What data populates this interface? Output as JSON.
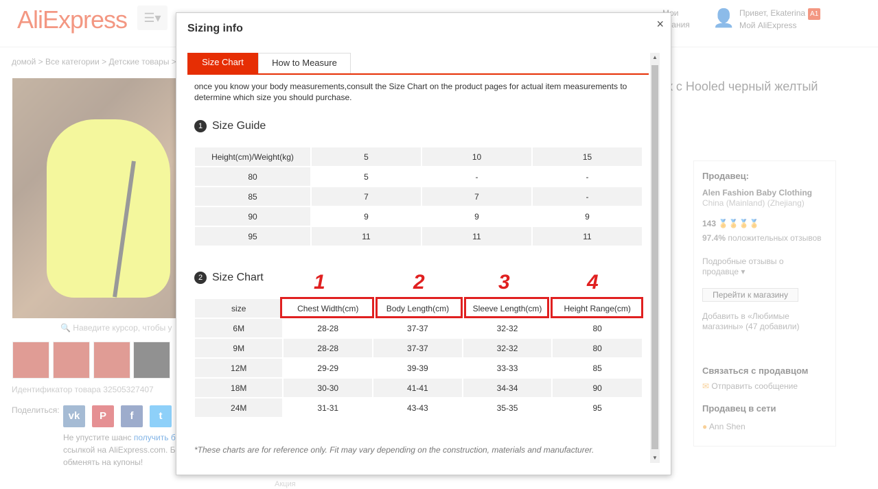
{
  "background": {
    "logo": "AliExpress",
    "breadcrumb": "домой > Все категории > Детские товары >",
    "hover_hint": "Наведите курсор, чтобы у",
    "product_id": "Идентификатор товара 32505327407",
    "share_label": "Поделиться:",
    "social": [
      "vk",
      "P",
      "f",
      "t"
    ],
    "promo_prefix": "Не упустите шанс",
    "promo_link": "получить б",
    "promo_rest": "ссылкой на AliExpress.com. Б обменять на купоны!",
    "title_fragment": "к с Hooled черный желтый",
    "account_greeting": "Привет, Ekaterina",
    "account_badge": "A1",
    "account_link": "Мой AliExpress",
    "wish_line1": "Мои",
    "wish_line2": "елания",
    "bottom_strip": "Акция",
    "seller": {
      "heading": "Продавец:",
      "store_name": "Alen Fashion Baby Clothing",
      "location": "China (Mainland) (Zhejiang)",
      "score": "143",
      "positive_pct": "97.4%",
      "positive_label": "положительных отзывов",
      "reviews_link": "Подробные отзывы о продавце",
      "store_button": "Перейти к магазину",
      "favorites": "Добавить в «Любимые магазины»",
      "favorites_count": "(47 добавили)",
      "contact_heading": "Связаться с продавцом",
      "send_message": "Отправить сообщение",
      "online_heading": "Продавец в сети",
      "online_name": "Ann Shen"
    }
  },
  "modal": {
    "title": "Sizing info",
    "close": "×",
    "tabs": [
      "Size Chart",
      "How to Measure"
    ],
    "intro": "once you know your body measurements,consult the Size Chart on the product pages for actual item measurements to determine which size you should purchase.",
    "size_guide": {
      "number": "1",
      "title": "Size Guide",
      "header": [
        "Height(cm)/Weight(kg)",
        "5",
        "10",
        "15"
      ],
      "rows": [
        [
          "80",
          "5",
          "-",
          "-"
        ],
        [
          "85",
          "7",
          "7",
          "-"
        ],
        [
          "90",
          "9",
          "9",
          "9"
        ],
        [
          "95",
          "11",
          "11",
          "11"
        ]
      ]
    },
    "size_chart": {
      "number": "2",
      "title": "Size Chart",
      "header": [
        "size",
        "Chest Width(cm)",
        "Body Length(cm)",
        "Sleeve Length(cm)",
        "Height Range(cm)"
      ],
      "rows": [
        [
          "6M",
          "28-28",
          "37-37",
          "32-32",
          "80"
        ],
        [
          "9M",
          "28-28",
          "37-37",
          "32-32",
          "80"
        ],
        [
          "12M",
          "29-29",
          "39-39",
          "33-33",
          "85"
        ],
        [
          "18M",
          "30-30",
          "41-41",
          "34-34",
          "90"
        ],
        [
          "24M",
          "31-31",
          "43-43",
          "35-35",
          "95"
        ]
      ],
      "annotations": [
        "1",
        "2",
        "3",
        "4"
      ]
    },
    "note": "*These charts are for reference only. Fit may vary depending on the construction, materials and manufacturer."
  },
  "colors": {
    "accent": "#e62e04",
    "highlight": "#e02020"
  }
}
